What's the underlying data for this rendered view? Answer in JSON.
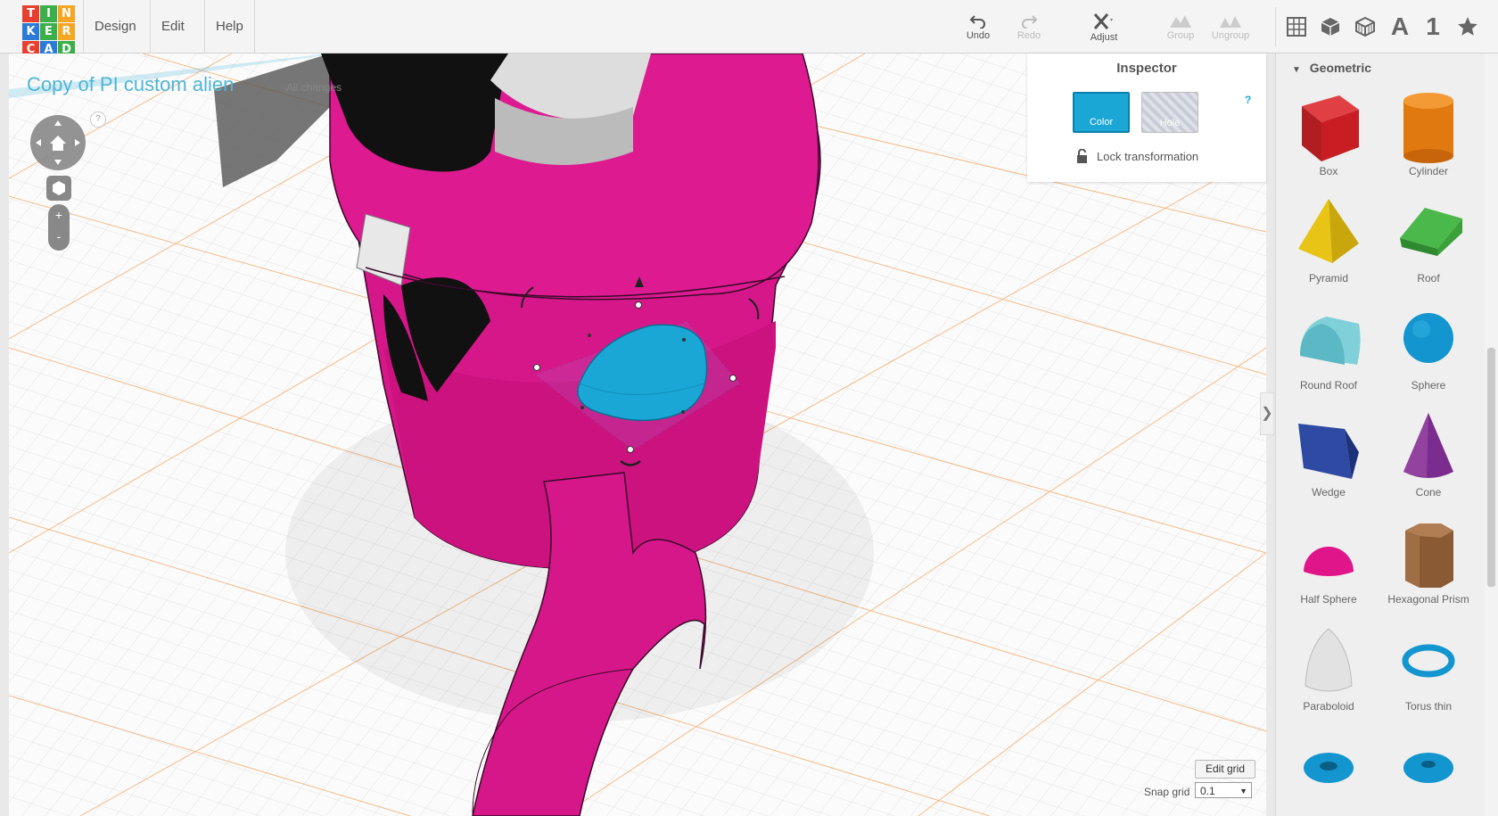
{
  "logo": {
    "letters": [
      "T",
      "I",
      "N",
      "K",
      "E",
      "R",
      "C",
      "A",
      "D"
    ],
    "colors": [
      "#e8402f",
      "#3cae4a",
      "#f5a623",
      "#2b7bd6",
      "#3cae4a",
      "#f5a623",
      "#e8402f",
      "#2b7bd6",
      "#3cae4a"
    ]
  },
  "menu": {
    "design": "Design",
    "edit": "Edit",
    "help": "Help"
  },
  "toolbar": {
    "undo": "Undo",
    "redo": "Redo",
    "adjust": "Adjust",
    "group": "Group",
    "ungroup": "Ungroup"
  },
  "view_buttons": {
    "text": "A",
    "number": "1"
  },
  "document": {
    "title": "Copy of PI custom alien",
    "status": "All changes"
  },
  "navigation": {
    "help": "?",
    "zoom_in": "+",
    "zoom_out": "-"
  },
  "inspector": {
    "title": "Inspector",
    "color_label": "Color",
    "hole_label": "Hole",
    "help": "?",
    "lock_label": "Lock transformation",
    "selected_color": "#1aa7d6"
  },
  "sidebar": {
    "section": "Geometric",
    "shapes": [
      {
        "label": "Box",
        "icon": "box-icon",
        "color": "#c81e23"
      },
      {
        "label": "Cylinder",
        "icon": "cylinder-icon",
        "color": "#e07a10"
      },
      {
        "label": "Pyramid",
        "icon": "pyramid-icon",
        "color": "#e8c417"
      },
      {
        "label": "Roof",
        "icon": "roof-icon",
        "color": "#3aa13a"
      },
      {
        "label": "Round Roof",
        "icon": "round-roof-icon",
        "color": "#6cc4cf"
      },
      {
        "label": "Sphere",
        "icon": "sphere-icon",
        "color": "#1395cf"
      },
      {
        "label": "Wedge",
        "icon": "wedge-icon",
        "color": "#283f8f"
      },
      {
        "label": "Cone",
        "icon": "cone-icon",
        "color": "#7a2c8f"
      },
      {
        "label": "Half Sphere",
        "icon": "half-sphere-icon",
        "color": "#e0158a"
      },
      {
        "label": "Hexagonal Prism",
        "icon": "hexagonal-prism-icon",
        "color": "#8a5a34"
      },
      {
        "label": "Paraboloid",
        "icon": "paraboloid-icon",
        "color": "#dcdcdc"
      },
      {
        "label": "Torus thin",
        "icon": "torus-thin-icon",
        "color": "#1395cf"
      },
      {
        "label": "",
        "icon": "torus-icon",
        "color": "#1395cf"
      },
      {
        "label": "",
        "icon": "tube-icon",
        "color": "#1395cf"
      }
    ]
  },
  "grid": {
    "edit_label": "Edit grid",
    "snap_label": "Snap grid",
    "snap_value": "0.1"
  },
  "colors": {
    "model_magenta": "#d6178a",
    "selection_blue": "#1aa7d6",
    "grid_orange": "#f2a25a"
  }
}
